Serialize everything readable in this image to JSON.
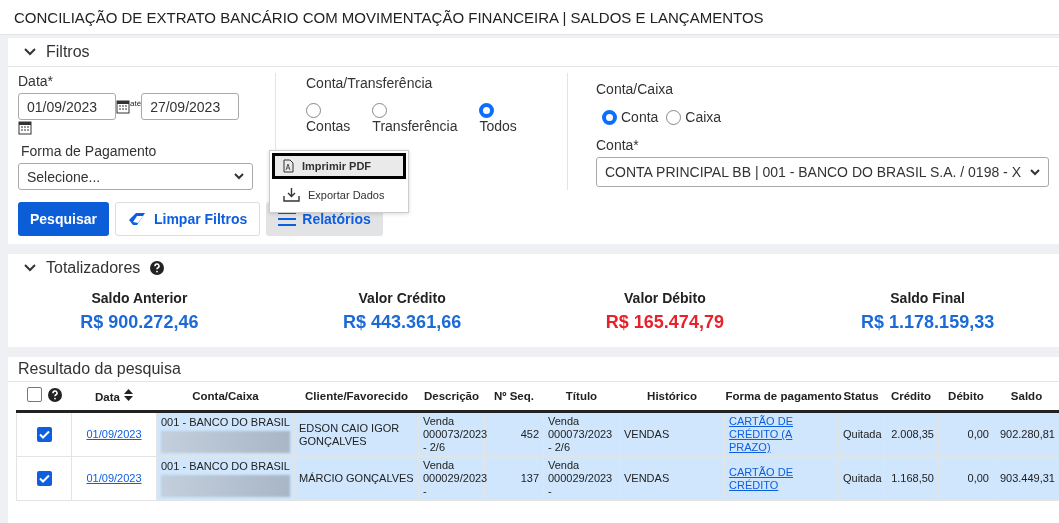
{
  "page_title": "CONCILIAÇÃO DE EXTRATO BANCÁRIO COM MOVIMENTAÇÃO FINANCEIRA | SALDOS E LANÇAMENTOS",
  "filters": {
    "title": "Filtros",
    "expanded": true,
    "date_label": "Data*",
    "date_from": "01/09/2023",
    "date_sep": "até",
    "date_to": "27/09/2023",
    "payment_label": "Forma de Pagamento",
    "payment_value": "Selecione...",
    "transfer_label": "Conta/Transferência",
    "transfer_options": [
      {
        "label": "Contas",
        "selected": false
      },
      {
        "label": "Transferência",
        "selected": false
      },
      {
        "label": "Todos",
        "selected": true
      }
    ],
    "account_type_label": "Conta/Caixa",
    "account_type_options": [
      {
        "label": "Conta",
        "selected": true
      },
      {
        "label": "Caixa",
        "selected": false
      }
    ],
    "account_label": "Conta*",
    "account_value": "CONTA PRINCIPAL BB | 001 - BANCO DO BRASIL S.A. / 0198 - X",
    "buttons": [
      {
        "label": "Pesquisar",
        "kind": "primary"
      },
      {
        "label": "Limpar Filtros",
        "kind": "clear"
      },
      {
        "label": "Relatórios",
        "kind": "menu"
      }
    ],
    "menu": [
      {
        "label": "Imprimir PDF",
        "kind": "pdf",
        "selected": true
      },
      {
        "label": "Exportar Dados",
        "kind": "export",
        "selected": false
      }
    ]
  },
  "totals": {
    "title": "Totalizadores",
    "expanded": true,
    "items": [
      {
        "label": "Saldo Anterior",
        "value": "R$ 900.272,46",
        "color": "#1b6ad8"
      },
      {
        "label": "Valor Crédito",
        "value": "R$ 443.361,66",
        "color": "#1b6ad8"
      },
      {
        "label": "Valor Débito",
        "value": "R$ 165.474,79",
        "color": "#e8222a"
      },
      {
        "label": "Saldo Final",
        "value": "R$ 1.178.159,33",
        "color": "#1b6ad8"
      }
    ]
  },
  "results": {
    "title": "Resultado da pesquisa",
    "select_all": false,
    "columns": [
      "Data",
      "Conta/Caixa",
      "Cliente/Favorecido",
      "Descrição",
      "Nº Seq.",
      "Título",
      "Histórico",
      "Forma de pagamento",
      "Status",
      "Crédito",
      "Débito",
      "Saldo"
    ],
    "rows": [
      {
        "selected": true,
        "cells": [
          "01/09/2023",
          "001 - BANCO DO BRASIL",
          "EDSON CAIO IGOR GONÇALVES",
          "Venda 000073/2023 - 2/6",
          "452",
          "Venda 000073/2023 - 2/6",
          "VENDAS",
          "CARTÃO DE CRÉDITO (A PRAZO)",
          "Quitada",
          "2.008,35",
          "0,00",
          "902.280,81"
        ]
      },
      {
        "selected": true,
        "cells": [
          "01/09/2023",
          "001 - BANCO DO BRASIL",
          "MÁRCIO GONÇALVES",
          "Venda 000029/2023 -",
          "137",
          "Venda 000029/2023 -",
          "VENDAS",
          "CARTÃO DE CRÉDITO",
          "Quitada",
          "1.168,50",
          "0,00",
          "903.449,31"
        ]
      }
    ]
  }
}
